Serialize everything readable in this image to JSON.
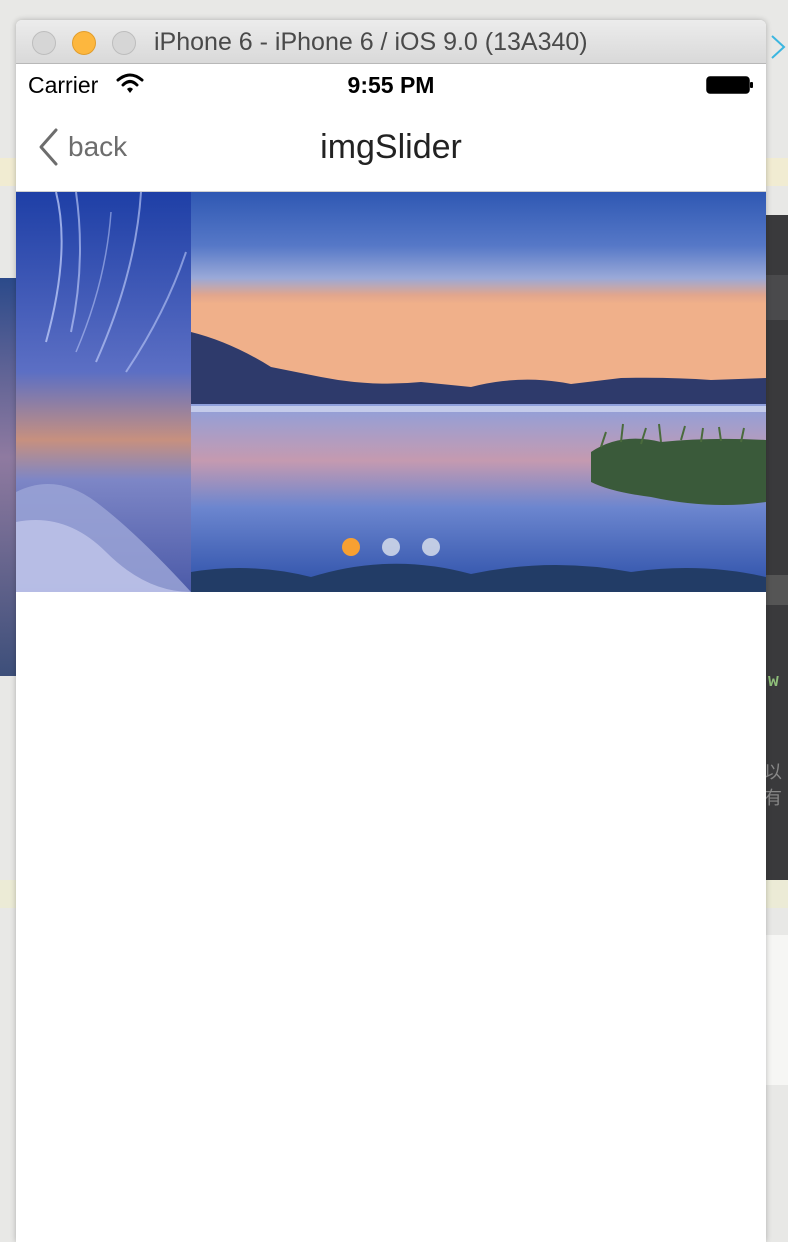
{
  "window": {
    "title": "iPhone 6 - iPhone 6 / iOS 9.0 (13A340)"
  },
  "status_bar": {
    "carrier": "Carrier",
    "time": "9:55 PM",
    "wifi_icon": "wifi-icon",
    "battery_icon": "battery-icon"
  },
  "nav_bar": {
    "back_label": "back",
    "back_icon": "chevron-left-icon",
    "title": "imgSlider"
  },
  "slider": {
    "page_count": 3,
    "current_page": 0,
    "colors": {
      "active_dot": "#f7a032",
      "inactive_dot": "#dde3ee"
    }
  },
  "desktop_background": {
    "right_edge_text": "w",
    "right_edge_text2": "以有"
  }
}
